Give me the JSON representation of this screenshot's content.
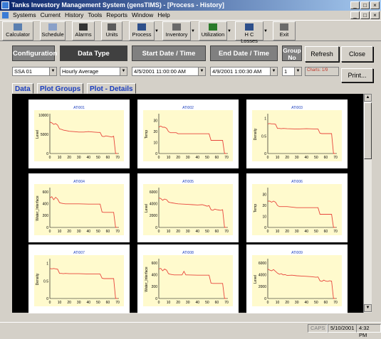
{
  "window": {
    "title": "Tanks Investory Management System (gensTIMS) - [Process - History]",
    "min": "_",
    "max": "□",
    "close": "×"
  },
  "menu": [
    "Systems",
    "Current",
    "History",
    "Tools",
    "Reports",
    "Window",
    "Help"
  ],
  "toolbar": [
    {
      "label": "Calculator",
      "icon": "calculator-icon",
      "x": 3,
      "w": 44
    },
    {
      "label": "Schedule",
      "icon": "calendar-icon",
      "x": 56,
      "w": 36
    },
    {
      "label": "Alarms",
      "icon": "bell-icon",
      "x": 101,
      "w": 32
    },
    {
      "label": "Units",
      "icon": "gauge-icon",
      "x": 142,
      "w": 30
    },
    {
      "label": "Process",
      "icon": "process-icon",
      "x": 181,
      "w": 36,
      "dd": true
    },
    {
      "label": "Inventory",
      "icon": "inventory-icon",
      "x": 228,
      "w": 40,
      "dd": true
    },
    {
      "label": "Utilization",
      "icon": "bar-chart-icon",
      "x": 279,
      "w": 40,
      "dd": true
    },
    {
      "label": "H C Losses",
      "icon": "funnel-icon",
      "x": 330,
      "w": 40,
      "dd": true
    },
    {
      "label": "Exit",
      "icon": "exit-icon",
      "x": 383,
      "w": 32
    }
  ],
  "headers": {
    "configuration": "Configuration",
    "data_type": "Data Type",
    "start": "Start Date / Time",
    "end": "End Date / Time",
    "group": "Group No"
  },
  "buttons": {
    "refresh": "Refresh",
    "close": "Close",
    "print": "Print..."
  },
  "selects": {
    "configuration": "SSA 01",
    "data_type": "Hourly Average",
    "start": "4/5/2001 11:00:00 AM",
    "end": "4/9/2001 1:00:30 AM",
    "group": "1"
  },
  "charts_label": "Charts: 1/9",
  "tabs": [
    "Data",
    "Plot Groups",
    "Plot - Details"
  ],
  "status": {
    "caps": "CAPS",
    "date": "5/10/2001",
    "time": "4:32 PM"
  },
  "colors": {
    "plot_bg": "#fffacd",
    "line": "#e8463c",
    "title": "#1a3dbf"
  },
  "chart_data": [
    {
      "type": "line",
      "title": "ATI001",
      "ylabel": "Level",
      "yticks": [
        "10000",
        "5000",
        "0"
      ],
      "ylim": [
        0,
        10000
      ],
      "xticks": [
        "0",
        "10",
        "20",
        "30",
        "40",
        "50",
        "60",
        "70"
      ],
      "xlim": [
        0,
        70
      ],
      "x": [
        0,
        2,
        4,
        6,
        8,
        10,
        12,
        14,
        16,
        18,
        20,
        25,
        30,
        35,
        40,
        45,
        50,
        52,
        54,
        56,
        58,
        60,
        62,
        64,
        66,
        68,
        70
      ],
      "y": [
        8200,
        8000,
        7600,
        7800,
        7400,
        6400,
        6300,
        6100,
        6000,
        5900,
        5800,
        5700,
        5600,
        5600,
        5700,
        5600,
        5500,
        5500,
        4500,
        4400,
        4600,
        4500,
        4400,
        4300,
        4500,
        0,
        0
      ]
    },
    {
      "type": "line",
      "title": "ATI002",
      "ylabel": "Temp",
      "yticks": [
        "30",
        "20",
        "10",
        "0"
      ],
      "ylim": [
        0,
        35
      ],
      "xticks": [
        "0",
        "10",
        "20",
        "30",
        "40",
        "50",
        "60",
        "70"
      ],
      "xlim": [
        0,
        70
      ],
      "x": [
        0,
        2,
        4,
        6,
        8,
        10,
        12,
        14,
        16,
        18,
        20,
        30,
        40,
        50,
        52,
        54,
        56,
        58,
        60,
        62,
        64,
        66,
        68,
        70
      ],
      "y": [
        24,
        25,
        24,
        24,
        23,
        20,
        19,
        19,
        19,
        19,
        18,
        18,
        18,
        18,
        18,
        12,
        12,
        12,
        12,
        12,
        12,
        12,
        0,
        0
      ]
    },
    {
      "type": "line",
      "title": "ATI003",
      "ylabel": "Density",
      "yticks": [
        "1",
        "0.5",
        "0"
      ],
      "ylim": [
        0,
        1.1
      ],
      "xticks": [
        "0",
        "10",
        "20",
        "30",
        "40",
        "50",
        "60",
        "70"
      ],
      "xlim": [
        0,
        70
      ],
      "x": [
        0,
        2,
        4,
        6,
        8,
        10,
        12,
        14,
        16,
        20,
        30,
        40,
        50,
        52,
        54,
        56,
        60,
        64,
        66,
        68,
        70
      ],
      "y": [
        0.85,
        0.86,
        0.85,
        0.85,
        0.84,
        0.72,
        0.72,
        0.71,
        0.72,
        0.71,
        0.7,
        0.71,
        0.7,
        0.7,
        0.58,
        0.57,
        0.57,
        0.57,
        0.57,
        0,
        0
      ]
    },
    {
      "type": "line",
      "title": "ATI004",
      "ylabel": "Water_Interface",
      "yticks": [
        "600",
        "400",
        "200",
        "0"
      ],
      "ylim": [
        0,
        650
      ],
      "xticks": [
        "0",
        "10",
        "20",
        "30",
        "40",
        "50",
        "60",
        "70"
      ],
      "xlim": [
        0,
        70
      ],
      "x": [
        0,
        2,
        4,
        6,
        8,
        10,
        12,
        14,
        16,
        20,
        30,
        40,
        50,
        52,
        54,
        56,
        60,
        64,
        66,
        68,
        70
      ],
      "y": [
        500,
        520,
        470,
        510,
        480,
        420,
        410,
        405,
        400,
        400,
        400,
        395,
        395,
        395,
        260,
        255,
        255,
        255,
        255,
        0,
        0
      ]
    },
    {
      "type": "line",
      "title": "ATI005",
      "ylabel": "Level",
      "yticks": [
        "6000",
        "4000",
        "2000",
        "0"
      ],
      "ylim": [
        0,
        6500
      ],
      "xticks": [
        "0",
        "10",
        "20",
        "30",
        "40",
        "50",
        "60",
        "70"
      ],
      "xlim": [
        0,
        70
      ],
      "x": [
        0,
        2,
        4,
        6,
        8,
        10,
        12,
        14,
        16,
        18,
        20,
        25,
        30,
        35,
        40,
        45,
        50,
        52,
        54,
        56,
        58,
        60,
        62,
        64,
        66,
        68,
        70
      ],
      "y": [
        5000,
        4900,
        4600,
        4800,
        4700,
        4300,
        4200,
        4150,
        4100,
        4050,
        4000,
        3950,
        3900,
        3850,
        3800,
        3850,
        3600,
        3700,
        3000,
        2900,
        3100,
        3000,
        2950,
        2900,
        3000,
        0,
        0
      ]
    },
    {
      "type": "line",
      "title": "ATI006",
      "ylabel": "Temp",
      "yticks": [
        "30",
        "20",
        "10",
        "0"
      ],
      "ylim": [
        0,
        35
      ],
      "xticks": [
        "0",
        "10",
        "20",
        "30",
        "40",
        "50",
        "60",
        "70"
      ],
      "xlim": [
        0,
        70
      ],
      "x": [
        0,
        2,
        4,
        6,
        8,
        10,
        12,
        14,
        16,
        20,
        30,
        40,
        50,
        52,
        54,
        56,
        60,
        64,
        66,
        68,
        70
      ],
      "y": [
        24,
        24,
        23,
        24,
        23,
        20,
        19,
        19,
        19,
        19,
        18,
        18,
        18,
        18,
        12,
        12,
        12,
        12,
        12,
        0,
        0
      ]
    },
    {
      "type": "line",
      "title": "ATI007",
      "ylabel": "Density",
      "yticks": [
        "1",
        "0.5",
        "0"
      ],
      "ylim": [
        0,
        1.1
      ],
      "xticks": [
        "0",
        "10",
        "20",
        "30",
        "40",
        "50",
        "60",
        "70"
      ],
      "xlim": [
        0,
        70
      ],
      "x": [
        0,
        2,
        4,
        6,
        8,
        10,
        12,
        14,
        16,
        20,
        30,
        40,
        50,
        52,
        54,
        56,
        60,
        64,
        66,
        68,
        70
      ],
      "y": [
        0.86,
        0.85,
        0.86,
        0.85,
        0.84,
        0.72,
        0.72,
        0.71,
        0.72,
        0.71,
        0.71,
        0.7,
        0.7,
        0.7,
        0.58,
        0.57,
        0.57,
        0.57,
        0.57,
        0,
        0
      ]
    },
    {
      "type": "line",
      "title": "ATI008",
      "ylabel": "Water_Interface",
      "yticks": [
        "600",
        "400",
        "200",
        "0"
      ],
      "ylim": [
        0,
        650
      ],
      "xticks": [
        "0",
        "10",
        "20",
        "30",
        "40",
        "50",
        "60",
        "70"
      ],
      "xlim": [
        0,
        70
      ],
      "x": [
        0,
        2,
        4,
        6,
        8,
        10,
        12,
        14,
        16,
        20,
        24,
        26,
        28,
        30,
        40,
        50,
        52,
        54,
        56,
        60,
        64,
        66,
        68,
        70
      ],
      "y": [
        500,
        510,
        470,
        500,
        480,
        420,
        410,
        405,
        400,
        400,
        400,
        460,
        400,
        400,
        395,
        395,
        395,
        260,
        255,
        255,
        255,
        255,
        0,
        0
      ]
    },
    {
      "type": "line",
      "title": "ATI009",
      "ylabel": "Level",
      "yticks": [
        "6000",
        "4000",
        "2000",
        "0"
      ],
      "ylim": [
        0,
        6500
      ],
      "xticks": [
        "0",
        "10",
        "20",
        "30",
        "40",
        "50",
        "60",
        "70"
      ],
      "xlim": [
        0,
        70
      ],
      "x": [
        0,
        2,
        4,
        6,
        8,
        10,
        12,
        14,
        16,
        18,
        20,
        25,
        30,
        35,
        40,
        45,
        50,
        52,
        54,
        56,
        58,
        60,
        62,
        64,
        66,
        68,
        70
      ],
      "y": [
        5000,
        4800,
        4700,
        4900,
        4600,
        4300,
        4100,
        4200,
        4000,
        4050,
        3900,
        3950,
        3850,
        3800,
        3750,
        3700,
        3600,
        3650,
        3000,
        2900,
        3100,
        2950,
        2900,
        3000,
        2950,
        0,
        0
      ]
    }
  ]
}
